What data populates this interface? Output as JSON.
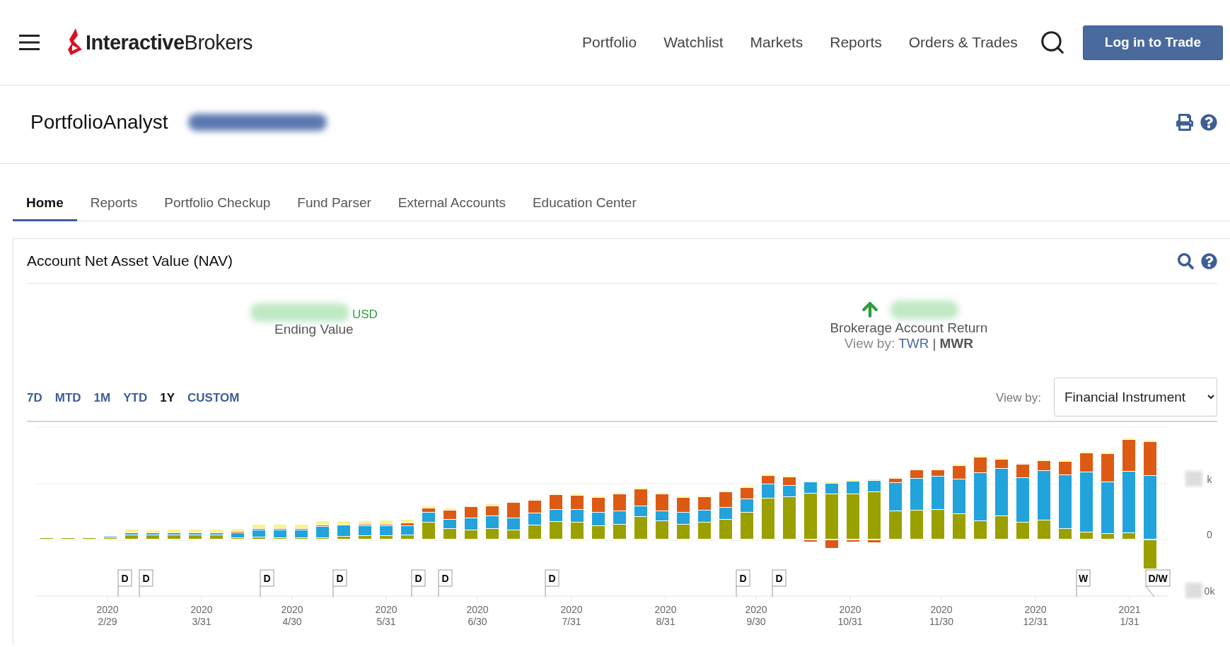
{
  "header": {
    "logo": "**Interactive**Brokers",
    "nav": [
      "Portfolio",
      "Watchlist",
      "Markets",
      "Reports",
      "Orders & Trades"
    ],
    "login_button": "Log in to Trade"
  },
  "page_title": "PortfolioAnalyst",
  "tabs": [
    {
      "label": "Home",
      "selected": true
    },
    {
      "label": "Reports",
      "selected": false
    },
    {
      "label": "Portfolio Checkup",
      "selected": false
    },
    {
      "label": "Fund Parser",
      "selected": false
    },
    {
      "label": "External Accounts",
      "selected": false
    },
    {
      "label": "Education Center",
      "selected": false
    }
  ],
  "nav_card": {
    "title": "Account Net Asset Value (NAV)",
    "ending_value": {
      "currency": "USD",
      "label": "Ending Value"
    },
    "account_return": {
      "label": "Brokerage Account Return",
      "view_by_label": "View by:",
      "separator": "|",
      "options": [
        {
          "label": "TWR",
          "selected": false
        },
        {
          "label": "MWR",
          "selected": true
        }
      ]
    },
    "ranges": [
      {
        "label": "7D",
        "selected": false
      },
      {
        "label": "MTD",
        "selected": false
      },
      {
        "label": "1M",
        "selected": false
      },
      {
        "label": "YTD",
        "selected": false
      },
      {
        "label": "1Y",
        "selected": true
      },
      {
        "label": "CUSTOM",
        "selected": false
      }
    ],
    "view_by": {
      "label": "View by:",
      "value": "Financial Instrument"
    },
    "chart": {
      "x_labels": [
        {
          "year": "2020",
          "date": "2/29"
        },
        {
          "year": "2020",
          "date": "3/31"
        },
        {
          "year": "2020",
          "date": "4/30"
        },
        {
          "year": "2020",
          "date": "5/31"
        },
        {
          "year": "2020",
          "date": "6/30"
        },
        {
          "year": "2020",
          "date": "7/31"
        },
        {
          "year": "2020",
          "date": "8/31"
        },
        {
          "year": "2020",
          "date": "9/30"
        },
        {
          "year": "2020",
          "date": "10/31"
        },
        {
          "year": "2020",
          "date": "11/30"
        },
        {
          "year": "2020",
          "date": "12/31"
        },
        {
          "year": "2021",
          "date": "1/31"
        }
      ],
      "y_labels": [
        "k",
        "0",
        "0k"
      ],
      "flags": [
        "D",
        "D",
        "D",
        "D",
        "D",
        "D",
        "D",
        "D",
        "D",
        "W",
        "D/W"
      ]
    }
  }
}
